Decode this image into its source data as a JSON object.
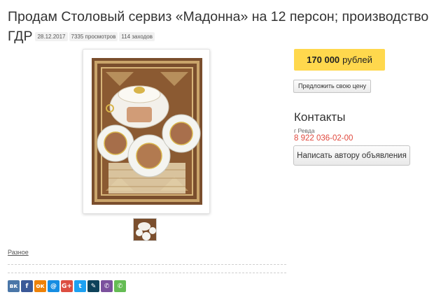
{
  "listing": {
    "title": "Продам Столовый сервиз «Мадонна» на 12 персон; производство ГДР",
    "date": "28.12.2017",
    "views": "7335 просмотров",
    "visits": "114 заходов"
  },
  "price": {
    "amount": "170 000",
    "currency": "рублей",
    "offer_button": "Предложить свою цену"
  },
  "contacts": {
    "title": "Контакты",
    "city": "г Ревда",
    "phone": "8 922 036-02-00",
    "write_button": "Написать автору объявления"
  },
  "category": "Разное",
  "share": [
    {
      "name": "vk-icon",
      "glyph": "вк",
      "color": "#4a76a8"
    },
    {
      "name": "facebook-icon",
      "glyph": "f",
      "color": "#3b5998"
    },
    {
      "name": "odnoklassniki-icon",
      "glyph": "ок",
      "color": "#ee8208"
    },
    {
      "name": "moimir-icon",
      "glyph": "@",
      "color": "#168de2"
    },
    {
      "name": "googleplus-icon",
      "glyph": "G+",
      "color": "#dc4e41"
    },
    {
      "name": "twitter-icon",
      "glyph": "t",
      "color": "#1da1f2"
    },
    {
      "name": "livejournal-icon",
      "glyph": "✎",
      "color": "#0d425a"
    },
    {
      "name": "viber-icon",
      "glyph": "✆",
      "color": "#7b519d"
    },
    {
      "name": "whatsapp-icon",
      "glyph": "✆",
      "color": "#65bc54"
    }
  ],
  "colors": {
    "price_bg": "#ffd84d",
    "phone": "#e0483d"
  }
}
